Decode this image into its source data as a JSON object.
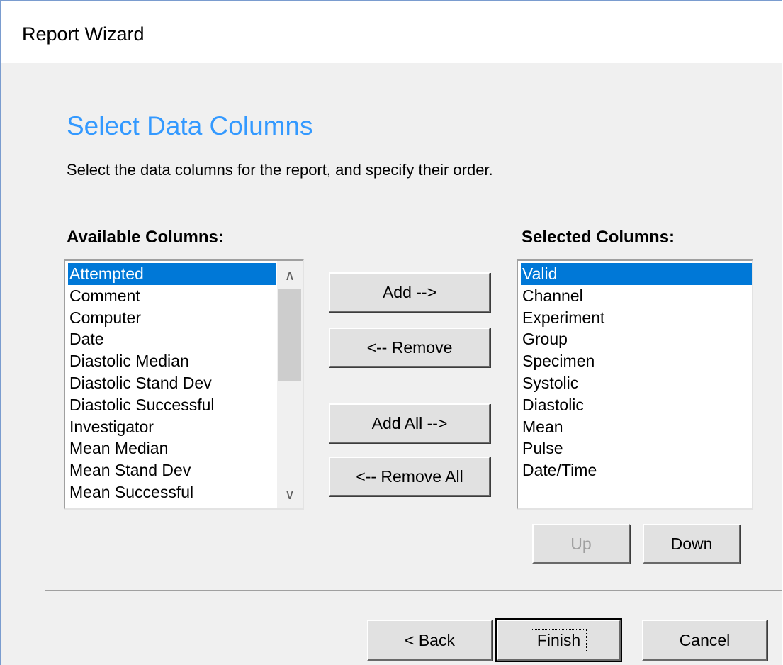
{
  "window": {
    "title": "Report Wizard"
  },
  "page": {
    "heading": "Select Data Columns",
    "instruction": "Select the data columns for the report, and specify their order."
  },
  "available": {
    "label": "Available Columns:",
    "items": [
      "Attempted",
      "Comment",
      "Computer",
      "Date",
      "Diastolic Median",
      "Diastolic Stand Dev",
      "Diastolic Successful",
      "Investigator",
      "Mean Median",
      "Mean Stand Dev",
      "Mean Successful",
      "Ordinal Median"
    ],
    "selected": "Attempted"
  },
  "selected_columns": {
    "label": "Selected Columns:",
    "items": [
      "Valid",
      "Channel",
      "Experiment",
      "Group",
      "Specimen",
      "Systolic",
      "Diastolic",
      "Mean",
      "Pulse",
      "Date/Time"
    ],
    "selected": "Valid"
  },
  "buttons": {
    "add": "Add -->",
    "remove": "<-- Remove",
    "add_all": "Add All -->",
    "remove_all": "<-- Remove All",
    "up": "Up",
    "down": "Down",
    "back": "< Back",
    "finish": "Finish",
    "cancel": "Cancel"
  },
  "icons": {
    "scroll_up": "chevron-up-icon",
    "scroll_down": "chevron-down-icon"
  },
  "colors": {
    "heading": "#3399ff",
    "selection": "#0078d7"
  }
}
